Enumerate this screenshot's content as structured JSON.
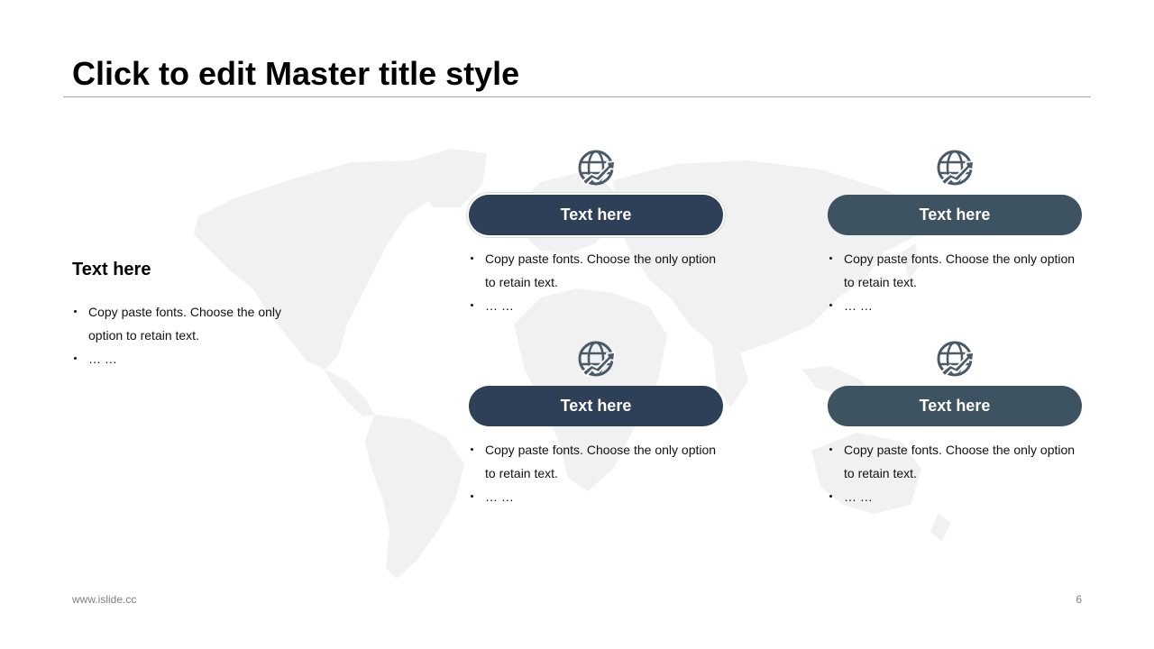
{
  "slide": {
    "title": "Click to edit Master title style",
    "footer_url": "www.islide.cc",
    "page_number": "6"
  },
  "colors": {
    "pill_dark": "#2e4057",
    "pill_slate": "#3d5362",
    "icon": "#4a5a68",
    "map": "#f1f1f1"
  },
  "icons": {
    "map": "world-map",
    "card": "globe-growth-icon"
  },
  "side": {
    "heading": "Text here",
    "bullets": [
      "Copy paste fonts. Choose the only option to retain text.",
      "… …"
    ]
  },
  "cards": [
    {
      "label": "Text here",
      "bullets": [
        "Copy paste fonts. Choose the only option to retain text.",
        "… …"
      ]
    },
    {
      "label": "Text here",
      "bullets": [
        "Copy paste fonts. Choose the only option to retain text.",
        "… …"
      ]
    },
    {
      "label": "Text here",
      "bullets": [
        "Copy paste fonts. Choose the only option to retain text.",
        "… …"
      ]
    },
    {
      "label": "Text here",
      "bullets": [
        "Copy paste fonts. Choose the only option to retain text.",
        "… …"
      ]
    }
  ]
}
